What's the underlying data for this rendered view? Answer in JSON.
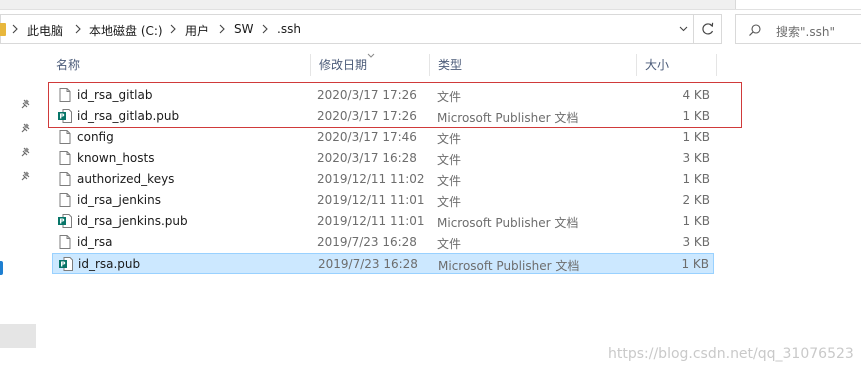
{
  "breadcrumb": {
    "items": [
      "此电脑",
      "本地磁盘 (C:)",
      "用户",
      "SW",
      ".ssh"
    ]
  },
  "search": {
    "placeholder": "搜索\".ssh\""
  },
  "columns": {
    "name": "名称",
    "modified": "修改日期",
    "type": "类型",
    "size": "大小"
  },
  "files": [
    {
      "name": "id_rsa_gitlab",
      "date": "2020/3/17 17:26",
      "type": "文件",
      "size": "4 KB",
      "icon": "file-icon"
    },
    {
      "name": "id_rsa_gitlab.pub",
      "date": "2020/3/17 17:26",
      "type": "Microsoft Publisher 文档",
      "size": "1 KB",
      "icon": "publisher-icon"
    },
    {
      "name": "config",
      "date": "2020/3/17 17:46",
      "type": "文件",
      "size": "1 KB",
      "icon": "file-icon"
    },
    {
      "name": "known_hosts",
      "date": "2020/3/17 16:28",
      "type": "文件",
      "size": "3 KB",
      "icon": "file-icon"
    },
    {
      "name": "authorized_keys",
      "date": "2019/12/11 11:02",
      "type": "文件",
      "size": "1 KB",
      "icon": "file-icon"
    },
    {
      "name": "id_rsa_jenkins",
      "date": "2019/12/11 11:01",
      "type": "文件",
      "size": "2 KB",
      "icon": "file-icon"
    },
    {
      "name": "id_rsa_jenkins.pub",
      "date": "2019/12/11 11:01",
      "type": "Microsoft Publisher 文档",
      "size": "1 KB",
      "icon": "publisher-icon"
    },
    {
      "name": "id_rsa",
      "date": "2019/7/23 16:28",
      "type": "文件",
      "size": "3 KB",
      "icon": "file-icon"
    },
    {
      "name": "id_rsa.pub",
      "date": "2019/7/23 16:28",
      "type": "Microsoft Publisher 文档",
      "size": "1 KB",
      "icon": "publisher-icon",
      "selected": true
    }
  ],
  "watermark": "https://blog.csdn.net/qq_31076523",
  "colors": {
    "selection": "#cce8ff",
    "selectionBorder": "#99d1ff",
    "highlight": "#d03a3a",
    "publisher": "#077568"
  }
}
